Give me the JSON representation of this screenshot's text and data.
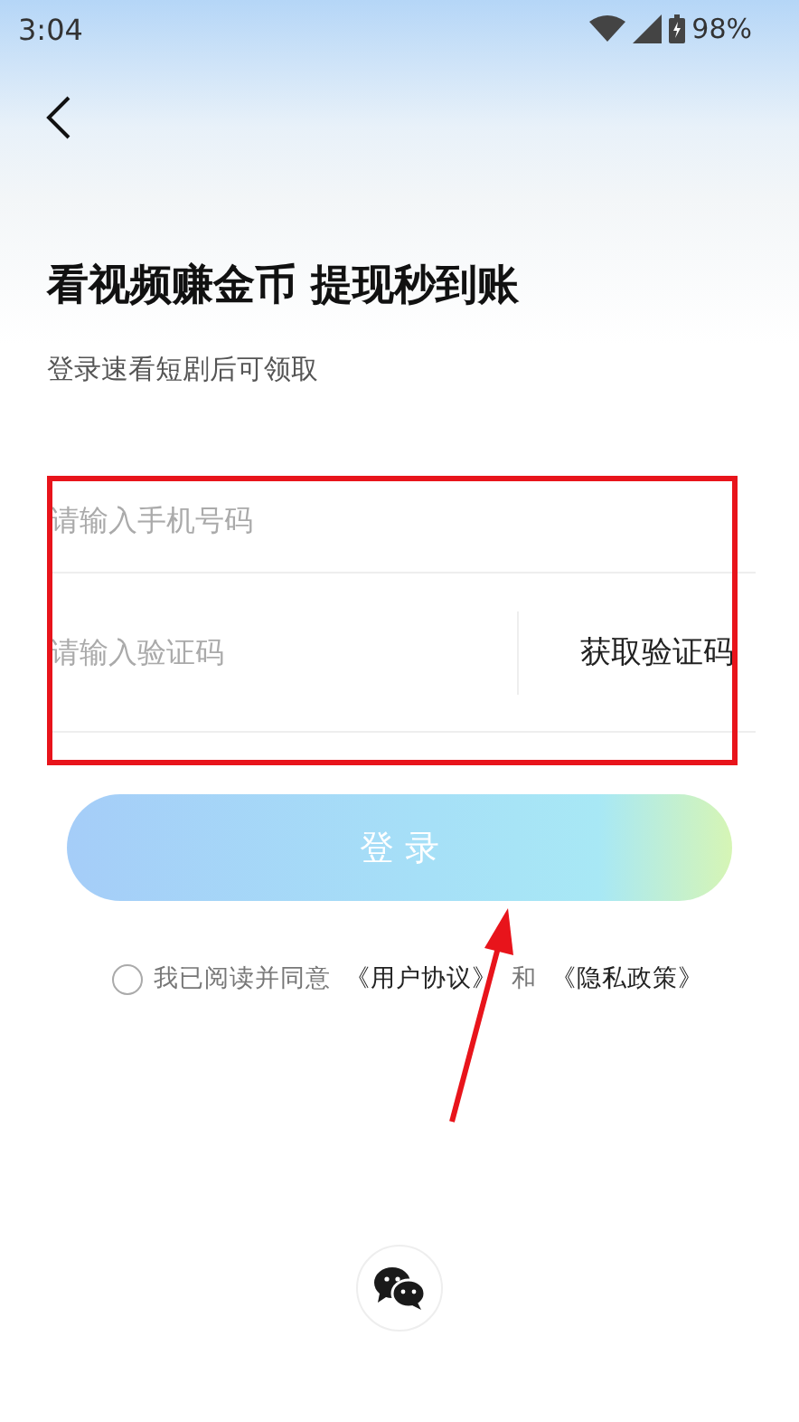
{
  "status_bar": {
    "time": "3:04",
    "battery": "98%"
  },
  "heading": {
    "title": "看视频赚金币 提现秒到账",
    "subtitle": "登录速看短剧后可领取"
  },
  "form": {
    "phone": {
      "placeholder": "请输入手机号码"
    },
    "code": {
      "placeholder": "请输入验证码"
    },
    "get_code": "获取验证码"
  },
  "login_button": "登 录",
  "agreement": {
    "agreed": false,
    "parts": [
      {
        "kind": "text",
        "text": "我已阅读并同意"
      },
      {
        "kind": "link",
        "text": "《用户协议》"
      },
      {
        "kind": "text",
        "text": "和"
      },
      {
        "kind": "link",
        "text": "《隐私政策》"
      }
    ]
  }
}
